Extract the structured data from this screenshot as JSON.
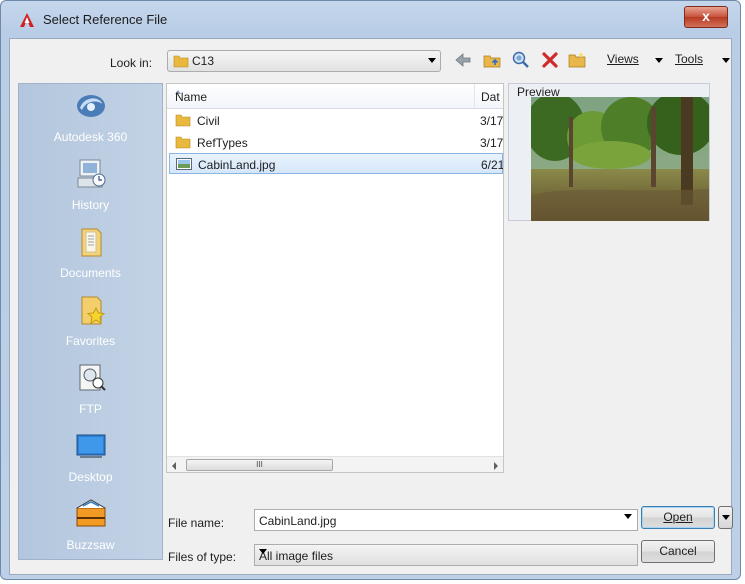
{
  "window": {
    "title": "Select Reference File",
    "close_label": "x"
  },
  "toolbar": {
    "look_in_label": "Look in:",
    "look_in_value": "C13",
    "views_label": "Views",
    "tools_label": "Tools",
    "icons": [
      "back-icon",
      "up-folder-icon",
      "search-web-icon",
      "delete-icon",
      "new-folder-icon"
    ]
  },
  "places": [
    {
      "label": "Autodesk 360",
      "icon": "autodesk-360-icon"
    },
    {
      "label": "History",
      "icon": "history-icon"
    },
    {
      "label": "Documents",
      "icon": "documents-icon"
    },
    {
      "label": "Favorites",
      "icon": "favorites-icon"
    },
    {
      "label": "FTP",
      "icon": "ftp-icon"
    },
    {
      "label": "Desktop",
      "icon": "desktop-icon"
    },
    {
      "label": "Buzzsaw",
      "icon": "buzzsaw-icon"
    }
  ],
  "file_list": {
    "columns": [
      "Name",
      "Date"
    ],
    "date_header_visible": "Dat",
    "rows": [
      {
        "name": "Civil",
        "date": "3/17",
        "type": "folder",
        "selected": false
      },
      {
        "name": "RefTypes",
        "date": "3/17",
        "type": "folder",
        "selected": false
      },
      {
        "name": "CabinLand.jpg",
        "date": "6/21",
        "type": "image",
        "selected": true
      }
    ],
    "scroll_thumb_label": "III"
  },
  "preview": {
    "label": "Preview"
  },
  "form": {
    "file_name_label": "File name:",
    "file_name_value": "CabinLand.jpg",
    "file_type_label": "Files of type:",
    "file_type_value": "All image files",
    "open_label": "Open",
    "cancel_label": "Cancel"
  },
  "colors": {
    "sidebar": "#b7c9de",
    "selection": "#d5e6fa",
    "close": "#c7513b"
  }
}
